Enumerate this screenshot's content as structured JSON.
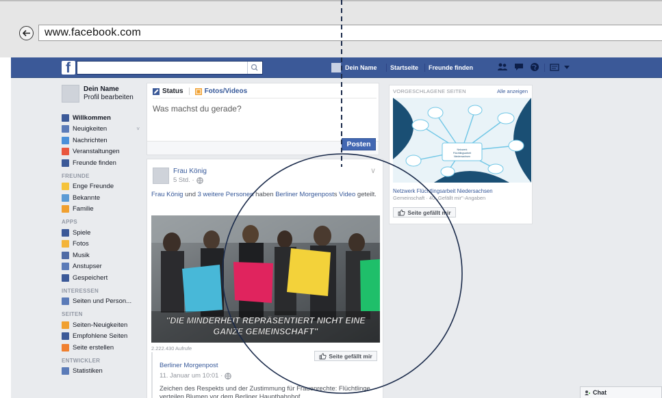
{
  "browser": {
    "url": "www.facebook.com"
  },
  "header": {
    "logo": "f",
    "profile_label": "Dein Name",
    "nav_home": "Startseite",
    "nav_find_friends": "Freunde finden"
  },
  "sidebar": {
    "profile_name": "Dein Name",
    "profile_edit": "Profil bearbeiten",
    "favorites": [
      {
        "label": "Willkommen",
        "bold": true,
        "color": "#3b5998"
      },
      {
        "label": "Neuigkeiten",
        "color": "#5b7bb8"
      },
      {
        "label": "Nachrichten",
        "color": "#4a90d9"
      },
      {
        "label": "Veranstaltungen",
        "color": "#e9573f"
      },
      {
        "label": "Freunde finden",
        "color": "#3b5998"
      }
    ],
    "friends_header": "FREUNDE",
    "friends": [
      {
        "label": "Enge Freunde",
        "color": "#f5c33b"
      },
      {
        "label": "Bekannte",
        "color": "#5b9bd5"
      },
      {
        "label": "Familie",
        "color": "#f0a030"
      }
    ],
    "apps_header": "APPS",
    "apps": [
      {
        "label": "Spiele",
        "color": "#3b5998"
      },
      {
        "label": "Fotos",
        "color": "#f3b43a"
      },
      {
        "label": "Musik",
        "color": "#4e6aa5"
      },
      {
        "label": "Anstupser",
        "color": "#5b7bb8"
      },
      {
        "label": "Gespeichert",
        "color": "#3b5998"
      }
    ],
    "interests_header": "INTERESSEN",
    "interests": [
      {
        "label": "Seiten und Person...",
        "color": "#5b7bb8"
      }
    ],
    "pages_header": "SEITEN",
    "pages": [
      {
        "label": "Seiten-Neuigkeiten",
        "color": "#f0a030"
      },
      {
        "label": "Empfohlene Seiten",
        "color": "#3b5998"
      },
      {
        "label": "Seite erstellen",
        "color": "#f08030"
      }
    ],
    "developer_header": "ENTWICKLER",
    "developer": [
      {
        "label": "Statistiken",
        "color": "#5b7bb8"
      }
    ]
  },
  "composer": {
    "tab_status": "Status",
    "tab_photos": "Fotos/Videos",
    "placeholder": "Was machst du gerade?",
    "post_button": "Posten"
  },
  "post": {
    "author": "Frau König",
    "time": "5 Std. ·",
    "text_author": "Frau König",
    "text_and": " und ",
    "text_others": "3 weitere Personen",
    "text_have": " haben ",
    "text_page": "Berliner Morgenpost",
    "text_s": "s ",
    "text_video": "Video",
    "text_shared": " geteilt.",
    "video_caption_1": "\"DIE MINDERHEIT REPRÄSENTIERT NICHT EINE",
    "video_caption_2": "GANZE GEMEINSCHAFT\"",
    "views": "2.222.430 Aufrufe",
    "like_page": "Seite gefällt mir",
    "shared_page": "Berliner Morgenpost",
    "shared_date": "11. Januar um 10:01 ·",
    "shared_text": "Zeichen des Respekts und der Zustimmung für Frauenrechte: Flüchtlinge verteilen Blumen vor dem Berliner Hauptbahnhof."
  },
  "suggested": {
    "header": "VORGESCHLAGENE SEITEN",
    "show_all": "Alle anzeigen",
    "image_title": "Netzwerk Flüchtlingsarbeit Niedersachsen",
    "page_name": "Netzwerk Flüchtlingsarbeit Niedersachsen",
    "page_meta": "Gemeinschaft · 40 „Gefällt mir\"-Angaben",
    "like_button": "Seite gefällt mir"
  },
  "chat": {
    "label": "Chat"
  },
  "colors": {
    "facebook_blue": "#3b5998",
    "link_blue": "#365899",
    "post_button": "#4267b2"
  }
}
